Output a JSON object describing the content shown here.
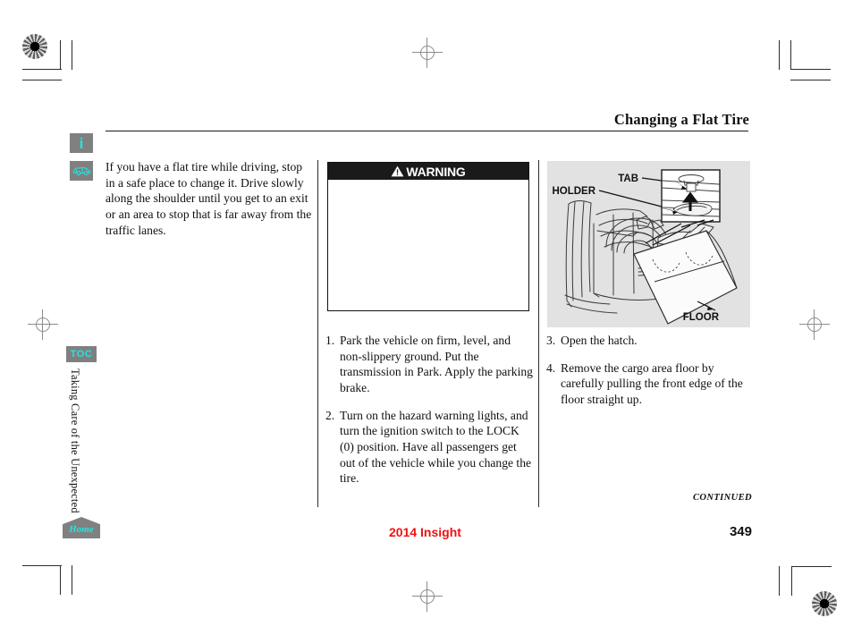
{
  "header": {
    "title": "Changing a Flat Tire"
  },
  "rail": {
    "info_icon_glyph": "i",
    "info_icon_name": "info-icon",
    "car_icon_name": "car-icon"
  },
  "sidebar": {
    "toc_label": "TOC",
    "section_label": "Taking Care of the Unexpected",
    "home_label": "Home"
  },
  "intro": {
    "text": "If you have a flat tire while driving, stop in a safe place to change it. Drive slowly along the shoulder until you get to an exit or an area to stop that is far away from the traffic lanes."
  },
  "warning": {
    "label": "WARNING",
    "body": ""
  },
  "steps_middle": [
    {
      "num": "1.",
      "text": "Park the vehicle on firm, level, and non-slippery ground. Put the transmission in Park. Apply the parking brake."
    },
    {
      "num": "2.",
      "text": "Turn on the hazard warning lights, and turn the ignition switch to the LOCK (0) position. Have all passengers get out of the vehicle while you change the tire."
    }
  ],
  "steps_right": [
    {
      "num": "3.",
      "text": "Open the hatch."
    },
    {
      "num": "4.",
      "text": "Remove the cargo area floor by carefully pulling the front edge of the floor straight up."
    }
  ],
  "illustration": {
    "callouts": {
      "tab": "TAB",
      "holder": "HOLDER",
      "floor": "FLOOR"
    },
    "background_color": "#e2e2e2"
  },
  "footer": {
    "continued": "CONTINUED",
    "model": "2014 Insight",
    "page_number": "349"
  },
  "colors": {
    "accent_cyan": "#22e4e4",
    "badge_gray": "#808080",
    "model_red": "#ee1111",
    "rule_black": "#1a1a1a"
  }
}
